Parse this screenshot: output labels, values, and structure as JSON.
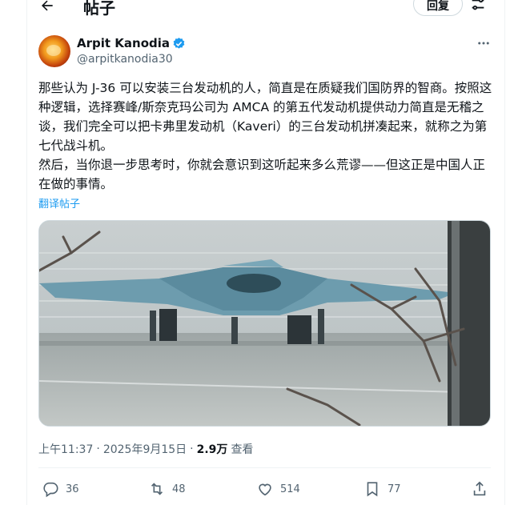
{
  "header": {
    "title": "帖子",
    "reply_label": "回复"
  },
  "author": {
    "name": "Arpit Kanodia",
    "handle": "@arpitkanodia30"
  },
  "tweet": {
    "paragraph1": "那些认为 J-36 可以安装三台发动机的人，简直是在质疑我们国防界的智商。按照这种逻辑，选择赛峰/斯奈克玛公司为 AMCA 的第五代发动机提供动力简直是无稽之谈，我们完全可以把卡弗里发动机（Kaveri）的三台发动机拼凑起来，就称之为第七代战斗机。",
    "paragraph2": "然后，当你退一步思考时，你就会意识到这听起来多么荒谬——但这正是中国人正在做的事情。",
    "translate_label": "翻译帖子"
  },
  "meta": {
    "time": "上午11:37",
    "date": "2025年9月15日",
    "views_count": "2.9万",
    "views_label": "查看",
    "sep": "·"
  },
  "actions": {
    "replies": "36",
    "reposts": "48",
    "likes": "514",
    "bookmarks": "77"
  },
  "colors": {
    "accent": "#1d9bf0",
    "secondary_text": "#536471",
    "border": "#eff3f4"
  },
  "icons": [
    "back-arrow-icon",
    "filter-icon",
    "verified-badge-icon",
    "more-icon",
    "reply-icon",
    "repost-icon",
    "like-icon",
    "bookmark-icon",
    "share-icon"
  ]
}
